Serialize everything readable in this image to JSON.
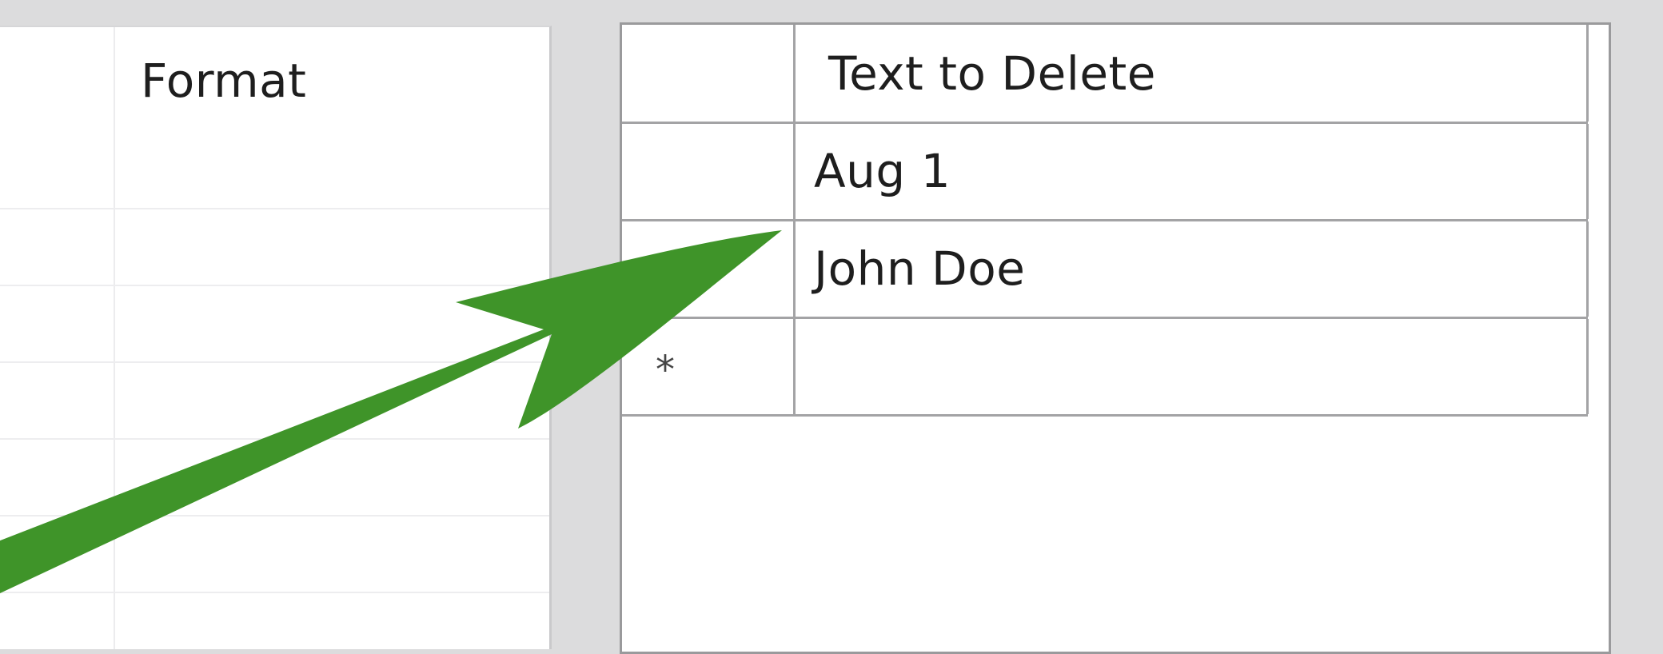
{
  "left_grid": {
    "column_header": "Format",
    "row_count": 6
  },
  "right_grid": {
    "column_header": "Text to Delete",
    "rows": [
      {
        "selector": "",
        "value": "Aug 1"
      },
      {
        "selector": "",
        "value": "John Doe"
      },
      {
        "selector": "*",
        "value": ""
      }
    ]
  },
  "annotation": {
    "arrow_color": "#3f9429",
    "arrow_icon": "arrow-annotation-icon"
  }
}
